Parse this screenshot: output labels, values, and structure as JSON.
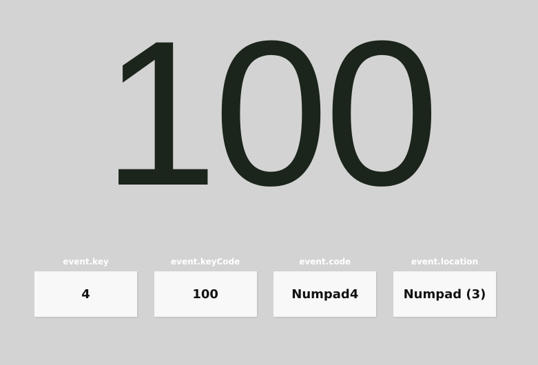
{
  "main": {
    "key_code_display": "100"
  },
  "cards": [
    {
      "label": "event.key",
      "value": "4"
    },
    {
      "label": "event.keyCode",
      "value": "100"
    },
    {
      "label": "event.code",
      "value": "Numpad4"
    },
    {
      "label": "event.location",
      "value": "Numpad (3)"
    }
  ],
  "colors": {
    "background": "#d3d3d3",
    "big_text": "#1b251b",
    "card_background": "#f8f8f8",
    "card_label": "#ffffff",
    "card_value": "#111111"
  }
}
